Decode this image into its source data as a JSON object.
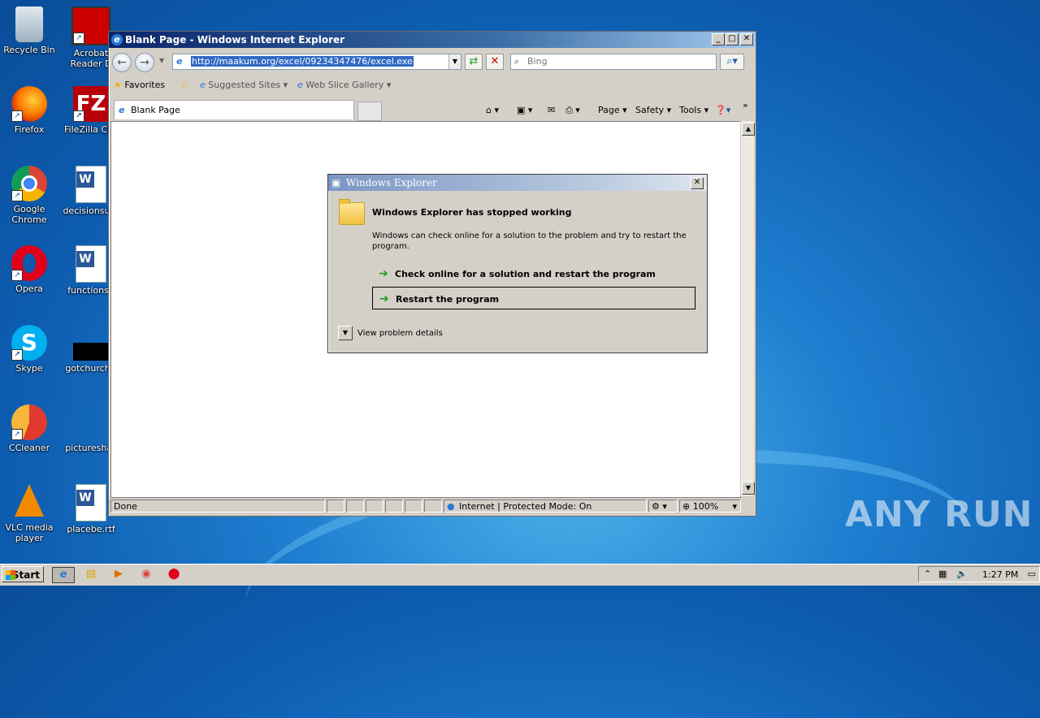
{
  "desktop": {
    "icons": [
      {
        "label": "Recycle Bin"
      },
      {
        "label": "Acrobat Reader D"
      },
      {
        "label": "Firefox"
      },
      {
        "label": "FileZilla Clie"
      },
      {
        "label": "Google Chrome"
      },
      {
        "label": "decisionsurv"
      },
      {
        "label": "Opera"
      },
      {
        "label": "functionsu"
      },
      {
        "label": "Skype"
      },
      {
        "label": "gotchurch.r"
      },
      {
        "label": "CCleaner"
      },
      {
        "label": "pictureshas"
      },
      {
        "label": "VLC media player"
      },
      {
        "label": "placebe.rtf"
      }
    ],
    "watermark": "ANY RUN"
  },
  "browser": {
    "title": "Blank Page - Windows Internet Explorer",
    "address": "http://maakum.org/excel/09234347476/excel.exe",
    "search_placeholder": "Bing",
    "favorites_label": "Favorites",
    "fav_items": [
      "Suggested Sites",
      "Web Slice Gallery"
    ],
    "tab_title": "Blank Page",
    "commands": [
      "Page",
      "Safety",
      "Tools"
    ],
    "status_text": "Done",
    "zone_text": "Internet | Protected Mode: On",
    "zoom": "100%"
  },
  "dialog": {
    "title": "Windows Explorer",
    "heading": "Windows Explorer has stopped working",
    "body": "Windows can check online for a solution to the problem and try to restart the program.",
    "option1": "Check online for a solution and restart the program",
    "option2": "Restart the program",
    "details": "View problem details"
  },
  "taskbar": {
    "start_label": "Start",
    "clock": "1:27 PM"
  }
}
